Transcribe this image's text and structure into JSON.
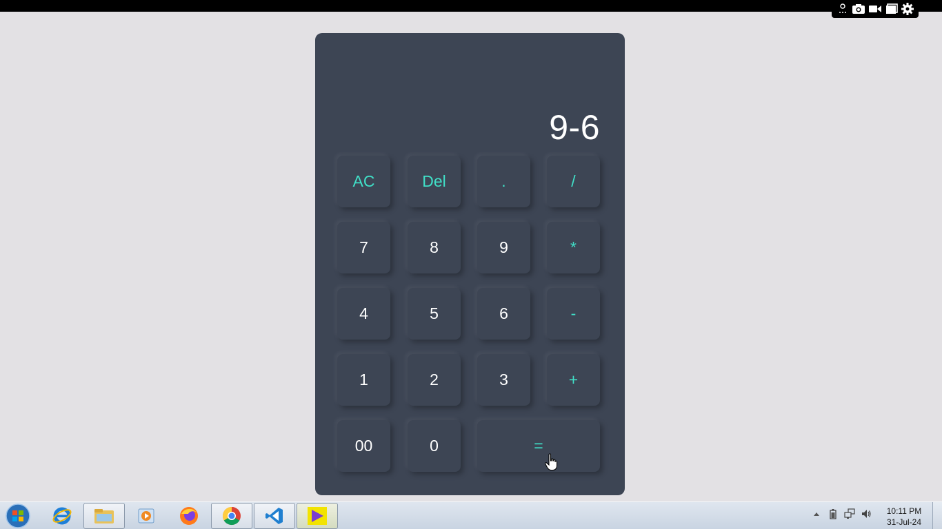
{
  "calculator": {
    "display": "9-6",
    "keys": {
      "ac": "AC",
      "del": "Del",
      "dot": ".",
      "divide": "/",
      "seven": "7",
      "eight": "8",
      "nine": "9",
      "multiply": "*",
      "four": "4",
      "five": "5",
      "six": "6",
      "minus": "-",
      "one": "1",
      "two": "2",
      "three": "3",
      "plus": "+",
      "double_zero": "00",
      "zero": "0",
      "equals": "="
    },
    "colors": {
      "body": "#3d4554",
      "operator_text": "#40e0c8",
      "digit_text": "#ffffff",
      "page_background": "#e3e1e4"
    }
  },
  "recorder_toolbar": {
    "icons": [
      "pin-icon",
      "camera-icon",
      "video-icon",
      "window-icon",
      "gear-icon"
    ]
  },
  "taskbar": {
    "apps": [
      "windows-start-icon",
      "internet-explorer-icon",
      "file-explorer-icon",
      "media-player-icon",
      "firefox-icon",
      "chrome-icon",
      "vscode-icon",
      "visual-studio-icon"
    ],
    "tray_icons": [
      "show-hidden-icons-chevron",
      "battery-icon",
      "network-icon",
      "volume-icon"
    ],
    "time": "10:11 PM",
    "date": "31-Jul-24"
  }
}
